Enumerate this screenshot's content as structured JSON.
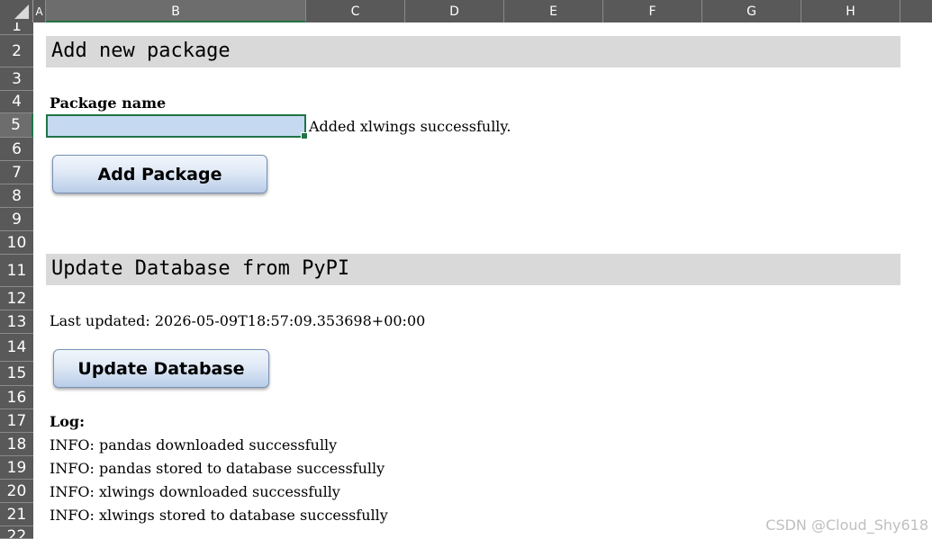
{
  "columns": [
    "A",
    "B",
    "C",
    "D",
    "E",
    "F",
    "G",
    "H"
  ],
  "rows": [
    "1",
    "2",
    "3",
    "4",
    "5",
    "6",
    "7",
    "8",
    "9",
    "10",
    "11",
    "12",
    "13",
    "14",
    "15",
    "16",
    "17",
    "18",
    "19",
    "20",
    "21",
    "22"
  ],
  "add_section": {
    "title": "Add new package",
    "package_label": "Package name",
    "package_value": "",
    "status": "Added xlwings successfully.",
    "button_label": "Add Package"
  },
  "update_section": {
    "title": "Update Database from PyPI",
    "last_updated": "Last updated: 2026-05-09T18:57:09.353698+00:00",
    "button_label": "Update Database"
  },
  "log": {
    "label": "Log:",
    "lines": [
      "INFO: pandas downloaded successfully",
      "INFO: pandas stored to database successfully",
      "INFO: xlwings downloaded successfully",
      "INFO: xlwings stored to database successfully"
    ]
  },
  "watermark": "CSDN @Cloud_Shy618",
  "colors": {
    "header_bg": "#595959",
    "section_band": "#d9d9d9",
    "selection": "#217346",
    "input_fill": "#c5d9f1"
  }
}
